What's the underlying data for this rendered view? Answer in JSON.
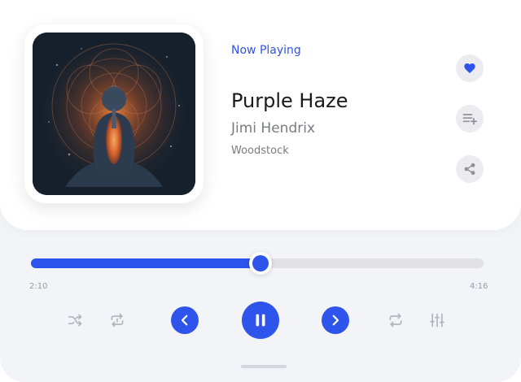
{
  "player": {
    "status": "Now Playing",
    "title": "Purple Haze",
    "artist": "Jimi Hendrix",
    "album": "Woodstock",
    "favorited": true
  },
  "progress": {
    "elapsed": "2:10",
    "duration": "4:16",
    "fraction": 0.508
  },
  "actions": {
    "favorite_icon": "heart-icon",
    "queue_icon": "add-to-playlist-icon",
    "share_icon": "share-icon"
  },
  "controls": {
    "shuffle_icon": "shuffle-icon",
    "repeat_one_icon": "repeat-one-icon",
    "previous_icon": "chevron-left-icon",
    "play_pause_icon": "pause-icon",
    "next_icon": "chevron-right-icon",
    "repeat_icon": "repeat-icon",
    "equalizer_icon": "equalizer-icon"
  },
  "colors": {
    "accent": "#2f54eb",
    "muted_icon": "#b4b4bc",
    "track_bg": "#e2e2e6"
  }
}
